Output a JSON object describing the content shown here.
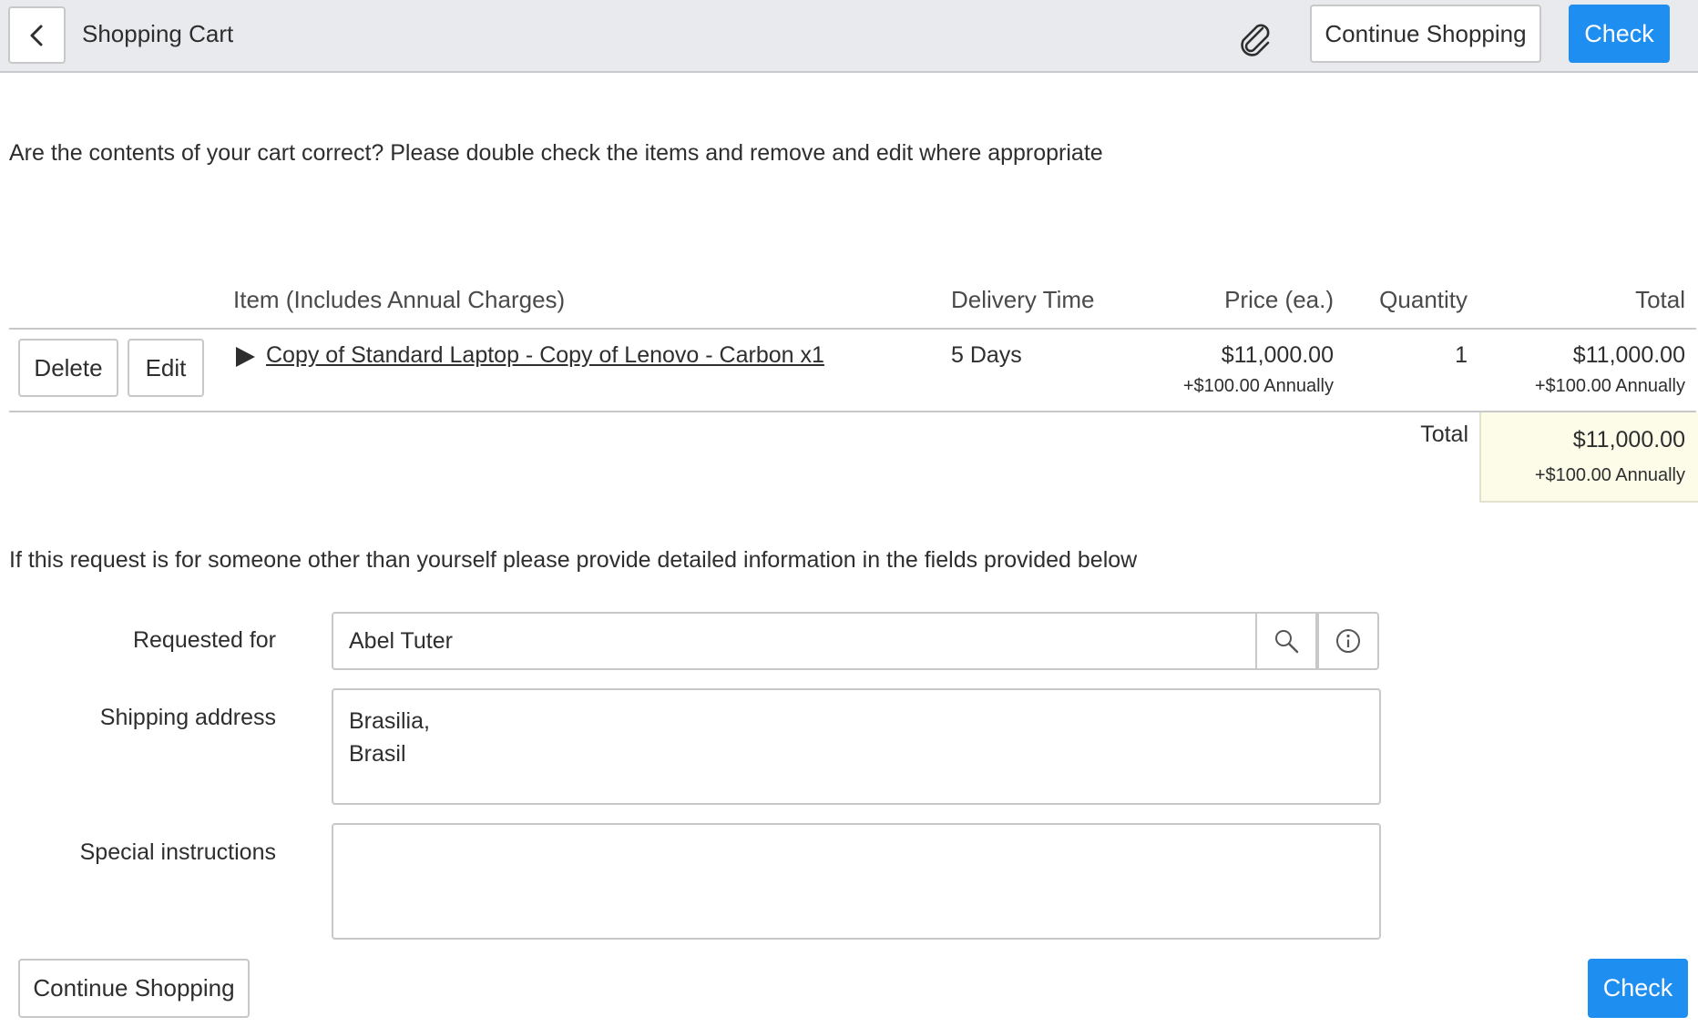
{
  "header": {
    "title": "Shopping Cart",
    "continue_label": "Continue Shopping",
    "check_label": "Check"
  },
  "intro_text": "Are the contents of your cart correct? Please double check the items and remove and edit where appropriate",
  "cart": {
    "columns": {
      "item": "Item (Includes Annual Charges)",
      "delivery": "Delivery Time",
      "price": "Price (ea.)",
      "quantity": "Quantity",
      "total": "Total"
    },
    "rows": [
      {
        "delete_label": "Delete",
        "edit_label": "Edit",
        "item": "Copy of Standard Laptop - Copy of Lenovo - Carbon x1",
        "delivery": "5 Days",
        "price": "$11,000.00",
        "price_recurring": "+$100.00 Annually",
        "quantity": "1",
        "total": "$11,000.00",
        "total_recurring": "+$100.00 Annually"
      }
    ],
    "grand_total": {
      "label": "Total",
      "amount": "$11,000.00",
      "recurring": "+$100.00 Annually"
    }
  },
  "request_note": "If this request is for someone other than yourself please provide detailed information in the fields provided below",
  "form": {
    "requested_for": {
      "label": "Requested for",
      "value": "Abel Tuter"
    },
    "shipping_address": {
      "label": "Shipping address",
      "line1": "Brasilia,",
      "line2": "Brasil"
    },
    "special_instructions": {
      "label": "Special instructions",
      "value": ""
    }
  },
  "footer": {
    "continue_label": "Continue Shopping",
    "check_label": "Check"
  },
  "icons": {
    "back": "chevron-left-icon",
    "attachment": "paperclip-icon",
    "expand": "caret-right-icon",
    "search": "search-icon",
    "info": "info-icon"
  },
  "colors": {
    "primary": "#1f8ef1",
    "header_bg": "#e8eaed",
    "total_highlight": "#fcfce8"
  }
}
